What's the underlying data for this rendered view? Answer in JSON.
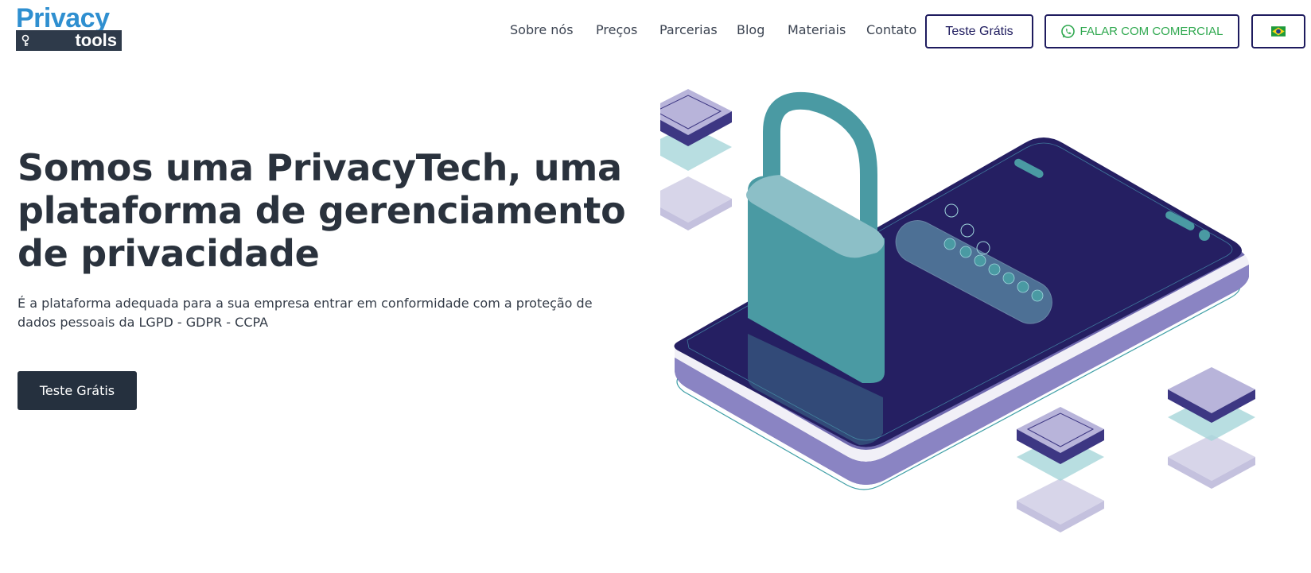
{
  "logo": {
    "top_text": "Privacy",
    "bottom_text": "tools"
  },
  "nav": {
    "items": [
      {
        "label": "Sobre nós"
      },
      {
        "label": "Preços"
      },
      {
        "label": "Parcerias"
      },
      {
        "label": "Blog"
      },
      {
        "label": "Materiais"
      },
      {
        "label": "Contato"
      }
    ],
    "trial_button": "Teste Grátis",
    "whatsapp_button": "FALAR COM COMERCIAL",
    "language": {
      "icon": "brazil-flag-icon"
    }
  },
  "hero": {
    "title": "Somos uma PrivacyTech, uma plataforma de gerenciamento de privacidade",
    "subtitle": "É a plataforma adequada para a sua empresa entrar em conformidade com a proteção de dados pessoais da LGPD - GDPR - CCPA",
    "cta": "Teste Grátis"
  },
  "colors": {
    "logo_blue": "#2f8fd0",
    "logo_dark": "#2e3a4a",
    "nav_text": "#3c4452",
    "outline_navy": "#1e1b5e",
    "whatsapp_green": "#2fa84f",
    "heading": "#2a323d",
    "cta_bg": "#25303e",
    "phone_screen": "#251f62",
    "lock_teal": "#4a9aa3",
    "lavender": "#b8b4da"
  }
}
